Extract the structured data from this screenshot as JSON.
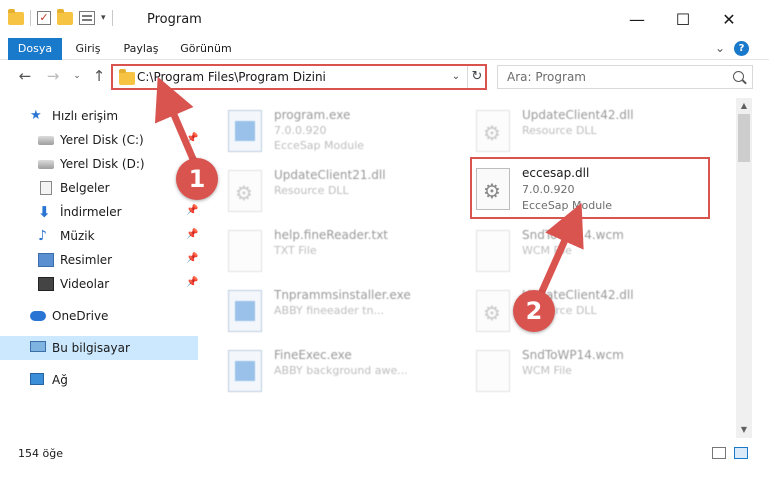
{
  "window": {
    "title": "Program"
  },
  "ribbon": {
    "tabs": [
      "Dosya",
      "Giriş",
      "Paylaş",
      "Görünüm"
    ]
  },
  "navigation": {
    "address": "C:\\Program Files\\Program Dizini",
    "search_placeholder": "Ara: Program"
  },
  "sidebar": {
    "items": [
      {
        "label": "Hızlı erişim",
        "icon": "star-icon",
        "pinned": false
      },
      {
        "label": "Yerel Disk (C:)",
        "icon": "disk-icon",
        "pinned": true
      },
      {
        "label": "Yerel Disk (D:)",
        "icon": "disk-icon",
        "pinned": true
      },
      {
        "label": "Belgeler",
        "icon": "document-icon",
        "pinned": true
      },
      {
        "label": "İndirmeler",
        "icon": "download-icon",
        "pinned": true
      },
      {
        "label": "Müzik",
        "icon": "music-icon",
        "pinned": true
      },
      {
        "label": "Resimler",
        "icon": "pictures-icon",
        "pinned": true
      },
      {
        "label": "Videolar",
        "icon": "videos-icon",
        "pinned": true
      },
      {
        "label": "OneDrive",
        "icon": "cloud-icon",
        "pinned": false
      },
      {
        "label": "Bu bilgisayar",
        "icon": "computer-icon",
        "pinned": false,
        "selected": true
      },
      {
        "label": "Ağ",
        "icon": "network-icon",
        "pinned": false
      }
    ]
  },
  "files": [
    {
      "name": "program.exe",
      "sub1": "7.0.0.920",
      "sub2": "EcceSap Module",
      "icon": "app-icon",
      "faded": true
    },
    {
      "name": "UpdateClient42.dll",
      "sub1": "Resource DLL",
      "sub2": "",
      "icon": "gear-file-icon",
      "faded": true
    },
    {
      "name": "UpdateClient21.dll",
      "sub1": "Resource DLL",
      "sub2": "",
      "icon": "gear-file-icon",
      "faded": true
    },
    {
      "name": "eccesap.dll",
      "sub1": "7.0.0.920",
      "sub2": "EcceSap Module",
      "icon": "gear-file-icon",
      "faded": false
    },
    {
      "name": "help.fineReader.txt",
      "sub1": "TXT File",
      "sub2": "",
      "icon": "text-file-icon",
      "faded": true
    },
    {
      "name": "SndToWP14.wcm",
      "sub1": "WCM File",
      "sub2": "",
      "icon": "blank-file-icon",
      "faded": true
    },
    {
      "name": "Tnprammsinstaller.exe",
      "sub1": "ABBY fineeader tn...",
      "sub2": "",
      "icon": "app-icon",
      "faded": true
    },
    {
      "name": "UpdateClient42.dll",
      "sub1": "Resource DLL",
      "sub2": "",
      "icon": "gear-file-icon",
      "faded": true
    },
    {
      "name": "FineExec.exe",
      "sub1": "ABBY background awe...",
      "sub2": "",
      "icon": "app-icon",
      "faded": true
    },
    {
      "name": "SndToWP14.wcm",
      "sub1": "WCM File",
      "sub2": "",
      "icon": "blank-file-icon",
      "faded": true
    }
  ],
  "status": {
    "count": "154 öğe"
  },
  "annotations": {
    "step1": "1",
    "step2": "2"
  },
  "colors": {
    "accent": "#1979ca",
    "highlight": "#d9534f",
    "selected": "#cce8ff"
  }
}
